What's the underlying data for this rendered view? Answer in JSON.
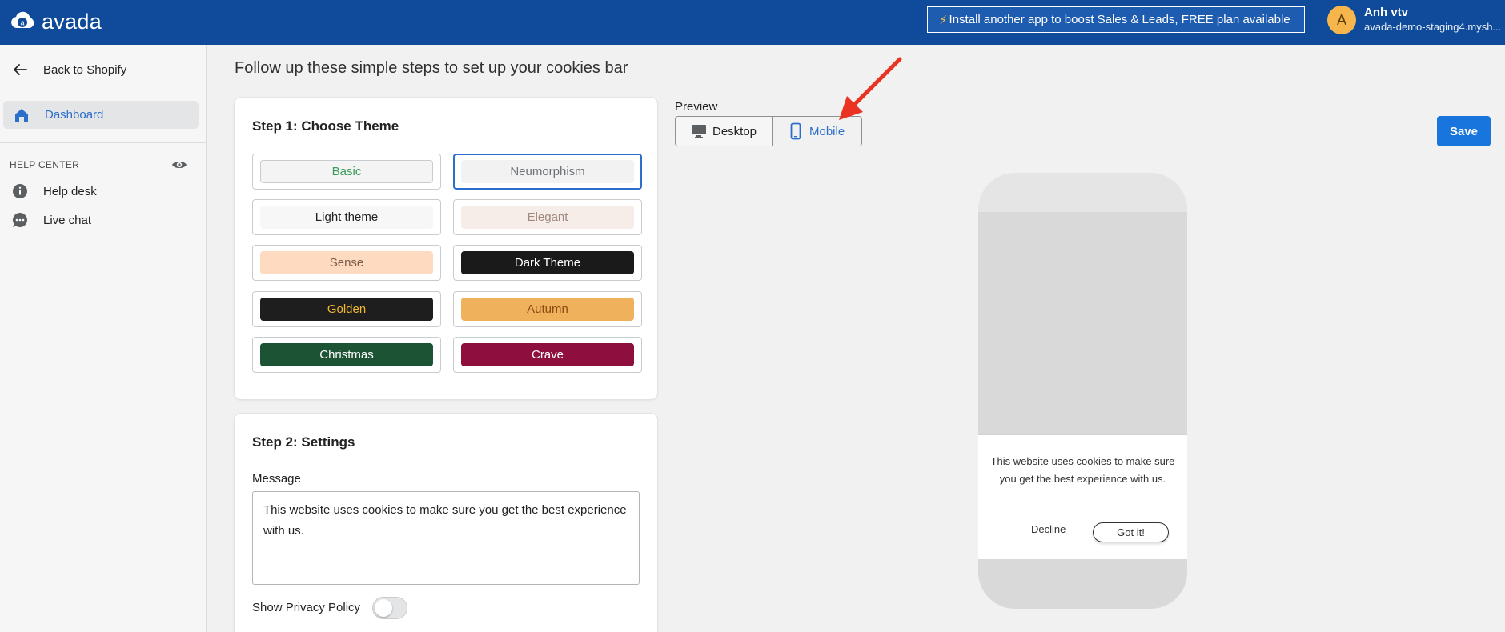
{
  "brand": {
    "name": "avada"
  },
  "topbar": {
    "promo_bolt": "⚡",
    "promo_text": "Install another app to boost Sales & Leads, FREE plan available",
    "user_initial": "A",
    "user_name": "Anh vtv",
    "user_store": "avada-demo-staging4.mysh..."
  },
  "sidebar": {
    "back_label": "Back to Shopify",
    "dashboard_label": "Dashboard",
    "help_center_label": "HELP CENTER",
    "items": [
      {
        "label": "Help desk"
      },
      {
        "label": "Live chat"
      }
    ]
  },
  "main": {
    "heading": "Follow up these simple steps to set up your cookies bar",
    "step1_title": "Step 1: Choose Theme",
    "themes": [
      {
        "label": "Basic",
        "bg": "#f4f4f4",
        "color": "#3a9a5b",
        "border": "#c9cccf",
        "selected": false
      },
      {
        "label": "Neumorphism",
        "bg": "#f2f2f2",
        "color": "#6d7175",
        "border": "none",
        "selected": true
      },
      {
        "label": "Light theme",
        "bg": "#f7f7f7",
        "color": "#202223",
        "border": "none",
        "selected": false
      },
      {
        "label": "Elegant",
        "bg": "#f7ede8",
        "color": "#a0897c",
        "border": "none",
        "selected": false
      },
      {
        "label": "Sense",
        "bg": "#fedac1",
        "color": "#7a5a45",
        "border": "none",
        "selected": false
      },
      {
        "label": "Dark Theme",
        "bg": "#1a1a1a",
        "color": "#ffffff",
        "border": "none",
        "selected": false
      },
      {
        "label": "Golden",
        "bg": "#1e1e1e",
        "color": "#f1b82d",
        "border": "none",
        "selected": false
      },
      {
        "label": "Autumn",
        "bg": "#f0b15d",
        "color": "#8a4a10",
        "border": "none",
        "selected": false
      },
      {
        "label": "Christmas",
        "bg": "#1b5334",
        "color": "#ffffff",
        "border": "none",
        "selected": false
      },
      {
        "label": "Crave",
        "bg": "#8e0f3d",
        "color": "#ffffff",
        "border": "none",
        "selected": false
      }
    ],
    "step2_title": "Step 2: Settings",
    "message_label": "Message",
    "message_value": "This website uses cookies to make sure you get the best experience with us.",
    "privacy_label": "Show Privacy Policy"
  },
  "preview": {
    "label": "Preview",
    "desktop_label": "Desktop",
    "mobile_label": "Mobile",
    "save_label": "Save",
    "cookie_message": "This website uses cookies to make sure you get the best experience with us.",
    "decline_label": "Decline",
    "accept_label": "Got it!"
  },
  "colors": {
    "topbar": "#0f4b9a",
    "accent": "#2c6ecb",
    "save": "#1775dd",
    "annotation_arrow": "#ea3323"
  }
}
